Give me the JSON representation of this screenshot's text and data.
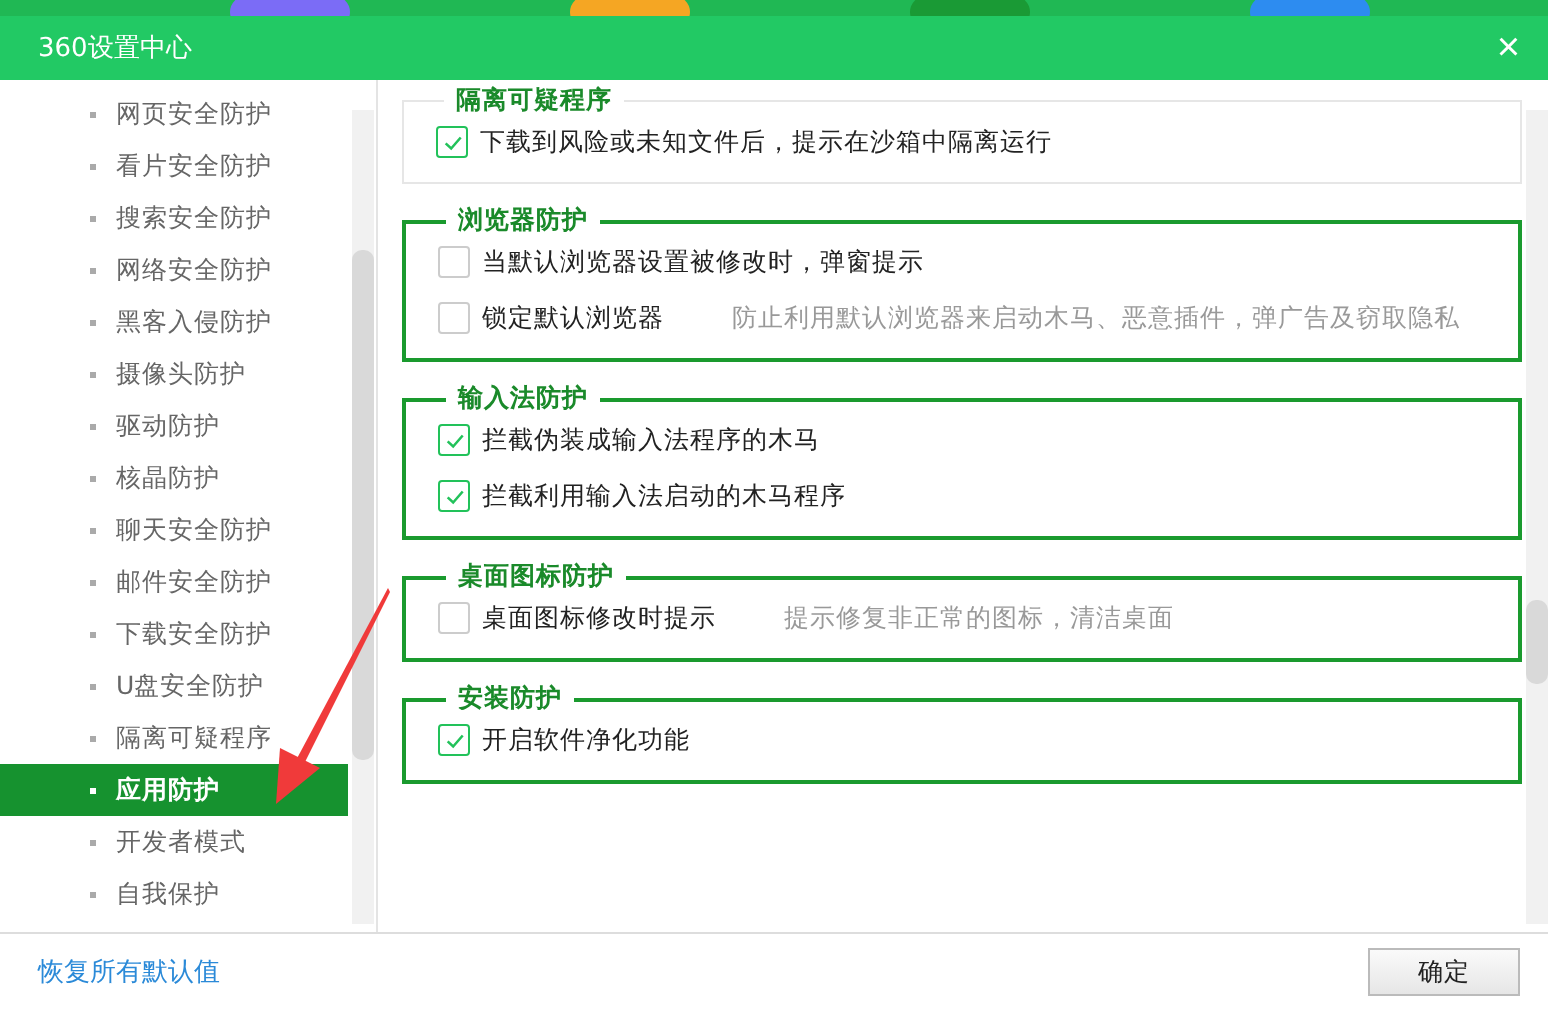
{
  "window": {
    "title": "360设置中心",
    "close": "×"
  },
  "sidebar": {
    "items": [
      {
        "label": "网页安全防护",
        "selected": false
      },
      {
        "label": "看片安全防护",
        "selected": false
      },
      {
        "label": "搜索安全防护",
        "selected": false
      },
      {
        "label": "网络安全防护",
        "selected": false
      },
      {
        "label": "黑客入侵防护",
        "selected": false
      },
      {
        "label": "摄像头防护",
        "selected": false
      },
      {
        "label": "驱动防护",
        "selected": false
      },
      {
        "label": "核晶防护",
        "selected": false
      },
      {
        "label": "聊天安全防护",
        "selected": false
      },
      {
        "label": "邮件安全防护",
        "selected": false
      },
      {
        "label": "下载安全防护",
        "selected": false
      },
      {
        "label": "U盘安全防护",
        "selected": false
      },
      {
        "label": "隔离可疑程序",
        "selected": false
      },
      {
        "label": "应用防护",
        "selected": true
      },
      {
        "label": "开发者模式",
        "selected": false
      },
      {
        "label": "自我保护",
        "selected": false
      }
    ]
  },
  "groups": [
    {
      "title": "隔离可疑程序",
      "highlighted": false,
      "options": [
        {
          "label": "下载到风险或未知文件后，提示在沙箱中隔离运行",
          "checked": true
        }
      ]
    },
    {
      "title": "浏览器防护",
      "highlighted": true,
      "options": [
        {
          "label": "当默认浏览器设置被修改时，弹窗提示",
          "checked": false
        },
        {
          "label": "锁定默认浏览器",
          "checked": false,
          "hint": "防止利用默认浏览器来启动木马、恶意插件，弹广告及窃取隐私"
        }
      ]
    },
    {
      "title": "输入法防护",
      "highlighted": true,
      "options": [
        {
          "label": "拦截伪装成输入法程序的木马",
          "checked": true
        },
        {
          "label": "拦截利用输入法启动的木马程序",
          "checked": true
        }
      ]
    },
    {
      "title": "桌面图标防护",
      "highlighted": true,
      "options": [
        {
          "label": "桌面图标修改时提示",
          "checked": false,
          "hint": "提示修复非正常的图标，清洁桌面"
        }
      ]
    },
    {
      "title": "安装防护",
      "highlighted": true,
      "options": [
        {
          "label": "开启软件净化功能",
          "checked": true
        }
      ]
    }
  ],
  "footer": {
    "reset_link": "恢复所有默认值",
    "ok_button": "确定"
  }
}
